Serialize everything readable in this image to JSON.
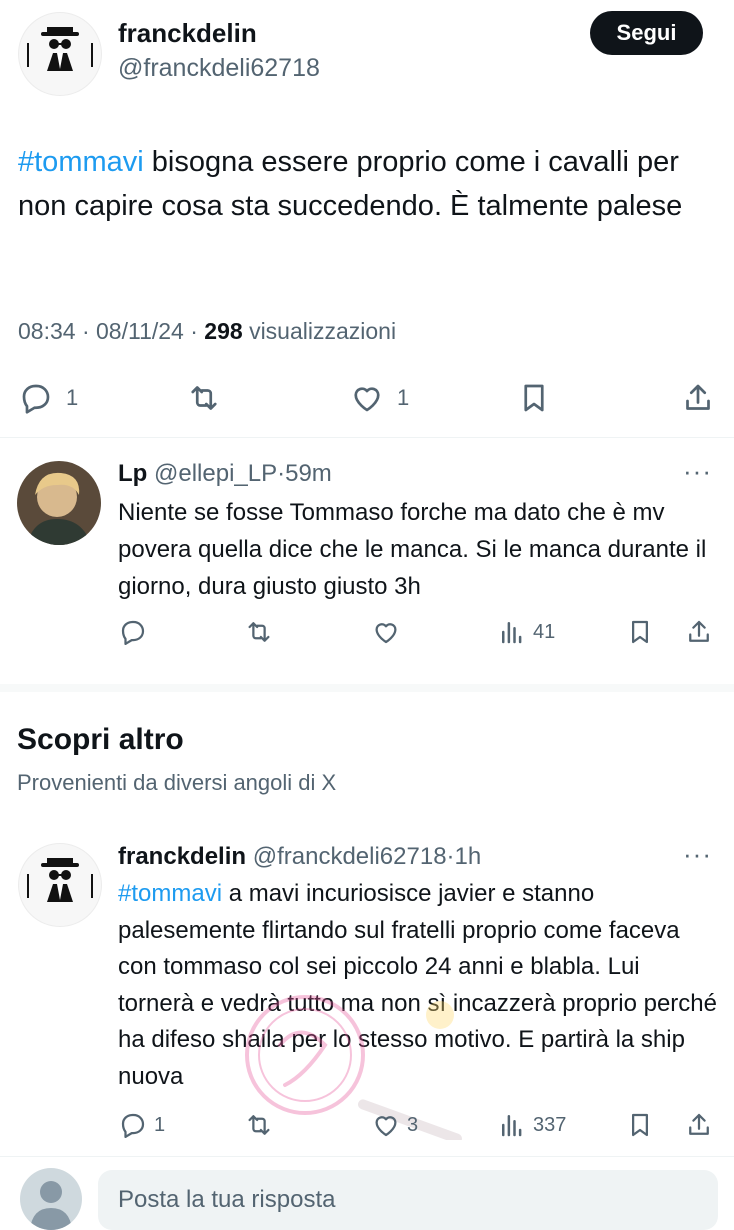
{
  "main_tweet": {
    "display_name": "franckdelin",
    "handle": "@franckdeli62718",
    "follow_label": "Segui",
    "hashtag": "#tommavi",
    "text": " bisogna essere proprio come i cavalli per non capire cosa sta succedendo. È talmente palese",
    "time": "08:34",
    "date": "08/11/24",
    "views": "298",
    "views_label": "visualizzazioni",
    "replies": "1",
    "likes": "1"
  },
  "reply": {
    "display_name": "Lp",
    "handle": "@ellepi_LP",
    "age": "59m",
    "text": "Niente se fosse Tommaso forche ma dato che è mv povera quella dice che le manca. Si le manca durante il giorno, dura giusto giusto 3h",
    "views": "41"
  },
  "discover": {
    "title": "Scopri altro",
    "subtitle": "Provenienti da diversi angoli di X"
  },
  "second_tweet": {
    "display_name": "franckdelin",
    "handle": "@franckdeli62718",
    "age": "1h",
    "hashtag": "#tommavi",
    "text": " a mavi incuriosisce javier e stanno palesemente flirtando sul fratelli proprio come faceva con tommaso col sei piccolo 24 anni e blabla. Lui tornerà e vedrà tutto ma non sì incazzerà proprio perché ha difeso shaila per lo stesso motivo. E partirà la ship nuova",
    "replies": "1",
    "likes": "3",
    "views": "337"
  },
  "compose": {
    "placeholder": "Posta la tua risposta"
  },
  "colors": {
    "accent": "#1d9bf0",
    "text": "#0f1419",
    "muted": "#536471"
  }
}
